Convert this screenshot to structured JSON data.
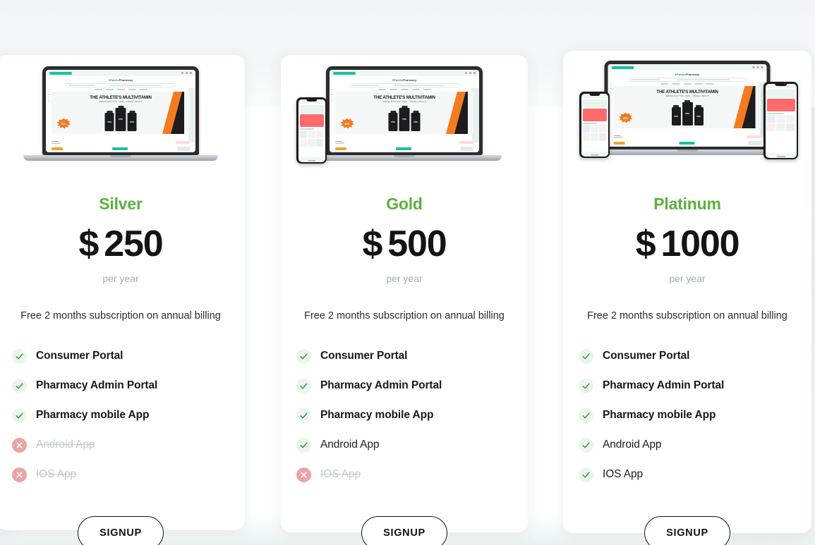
{
  "page": {
    "section_kind": "pricing-plans",
    "accent_green": "#5cb03c",
    "check_green": "#3f8f3f",
    "cross_red": "#eda4a4",
    "price_black": "#141414",
    "muted_gray": "#a7adb2"
  },
  "mockup": {
    "site_logo_heart": "♥",
    "site_logo_primary": "Publix",
    "site_logo_secondary": "Pharmacy",
    "hero_title": "THE ATHLETE'S MULTIVITAMIN",
    "hero_subtitle": "IMMUNE FUNCTION · MIND · OVERALL HEALTH",
    "discount_badge": "30%",
    "bottle_label": "VITA"
  },
  "plans": [
    {
      "id": "silver",
      "name": "Silver",
      "currency": "$",
      "amount": "250",
      "period": "per year",
      "note": "Free 2 months subscription on annual billing",
      "cta_label": "SIGNUP",
      "devices": [
        "laptop"
      ],
      "features": [
        {
          "label": "Consumer Portal",
          "included": true,
          "emphasis": "bold"
        },
        {
          "label": "Pharmacy Admin Portal",
          "included": true,
          "emphasis": "bold"
        },
        {
          "label": "Pharmacy mobile App",
          "included": true,
          "emphasis": "bold"
        },
        {
          "label": "Android App",
          "included": false,
          "emphasis": "bold"
        },
        {
          "label": "IOS App",
          "included": false,
          "emphasis": "bold"
        }
      ]
    },
    {
      "id": "gold",
      "name": "Gold",
      "currency": "$",
      "amount": "500",
      "period": "per year",
      "note": "Free 2 months subscription on annual billing",
      "cta_label": "SIGNUP",
      "devices": [
        "laptop",
        "phone-left"
      ],
      "features": [
        {
          "label": "Consumer Portal",
          "included": true,
          "emphasis": "bold"
        },
        {
          "label": "Pharmacy Admin Portal",
          "included": true,
          "emphasis": "bold"
        },
        {
          "label": "Pharmacy mobile App",
          "included": true,
          "emphasis": "bold"
        },
        {
          "label": "Android App",
          "included": true,
          "emphasis": "plain"
        },
        {
          "label": "IOS App",
          "included": false,
          "emphasis": "bold"
        }
      ]
    },
    {
      "id": "platinum",
      "name": "Platinum",
      "currency": "$",
      "amount": "1000",
      "period": "per year",
      "note": "Free 2 months subscription on annual billing",
      "cta_label": "SIGNUP",
      "devices": [
        "laptop",
        "phone-left",
        "phone-right"
      ],
      "features": [
        {
          "label": "Consumer Portal",
          "included": true,
          "emphasis": "bold"
        },
        {
          "label": "Pharmacy Admin Portal",
          "included": true,
          "emphasis": "bold"
        },
        {
          "label": "Pharmacy mobile App",
          "included": true,
          "emphasis": "bold"
        },
        {
          "label": "Android App",
          "included": true,
          "emphasis": "plain"
        },
        {
          "label": "IOS App",
          "included": true,
          "emphasis": "plain"
        }
      ]
    }
  ]
}
